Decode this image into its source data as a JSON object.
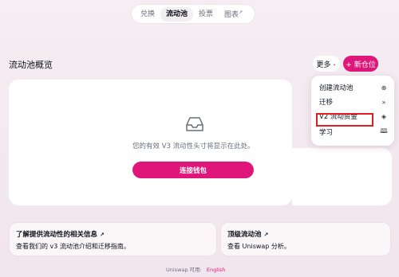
{
  "nav": {
    "tabs": [
      {
        "label": "兑换"
      },
      {
        "label": "流动池"
      },
      {
        "label": "投票"
      },
      {
        "label": "图表",
        "arrow": "↗"
      }
    ]
  },
  "page": {
    "title": "流动池概览",
    "more_label": "更多",
    "more_chevron": "⌄",
    "new_label": "+ 新仓位"
  },
  "empty_state": {
    "icon": "inbox-icon",
    "text": "您的有效 V3 流动性头寸将显示在此处。",
    "connect_label": "连接钱包"
  },
  "menu": {
    "items": [
      {
        "label": "创建流动池",
        "icon": "plus-circle-icon",
        "glyph": "⊕"
      },
      {
        "label": "迁移",
        "icon": "double-chevron-icon",
        "glyph": "»"
      },
      {
        "label": "V2 流动资金",
        "icon": "layers-icon",
        "glyph": "◈"
      },
      {
        "label": "学习",
        "icon": "book-icon",
        "glyph": "🕮"
      }
    ],
    "highlight_color": "#e02020"
  },
  "cards": [
    {
      "title": "了解提供流动性的相关信息",
      "arrow": "↗",
      "desc": "查看我们的 v3 流动池介绍和迁移指南。"
    },
    {
      "title": "顶级流动池",
      "arrow": "↗",
      "desc": "查看 Uniswap 分析。"
    }
  ],
  "footer": {
    "text": "Uniswap 可用:",
    "lang": "English"
  },
  "colors": {
    "accent": "#e0177b"
  }
}
